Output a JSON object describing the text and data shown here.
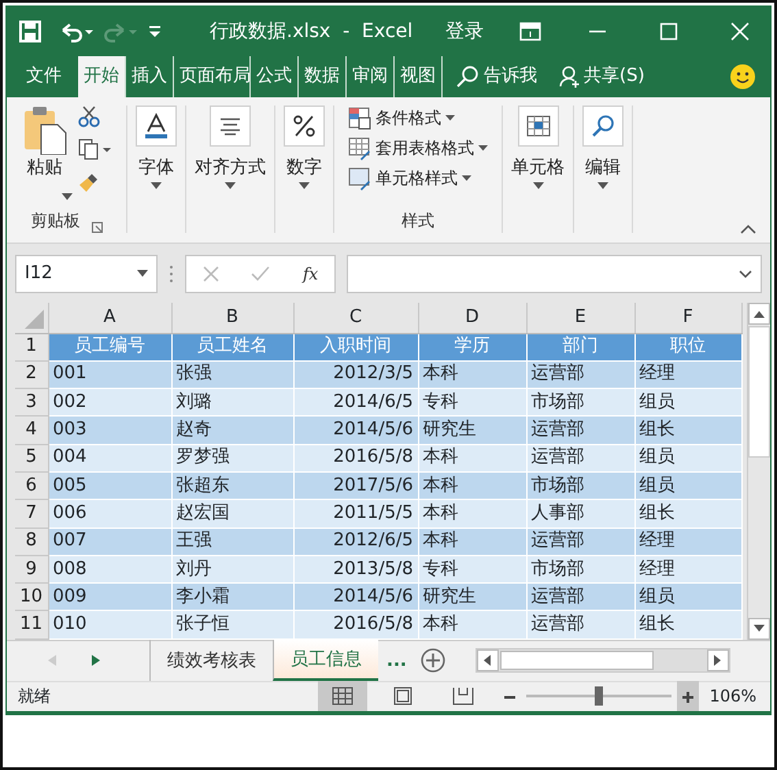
{
  "title_bar": {
    "title": "行政数据.xlsx  -  Excel",
    "sign_in": "登录"
  },
  "ribbon_tabs": [
    {
      "label": "文件",
      "selected": false
    },
    {
      "label": "开始",
      "selected": true
    },
    {
      "label": "插入",
      "selected": false
    },
    {
      "label": "页面布局",
      "selected": false
    },
    {
      "label": "公式",
      "selected": false
    },
    {
      "label": "数据",
      "selected": false
    },
    {
      "label": "审阅",
      "selected": false
    },
    {
      "label": "视图",
      "selected": false
    }
  ],
  "tell_me": "告诉我",
  "share": "共享(S)",
  "ribbon": {
    "clipboard": {
      "paste": "粘贴",
      "label": "剪贴板"
    },
    "font": "字体",
    "alignment": "对齐方式",
    "number": "数字",
    "styles": {
      "items": [
        "条件格式",
        "套用表格格式",
        "单元格样式"
      ],
      "label": "样式"
    },
    "cells": "单元格",
    "editing": "编辑"
  },
  "formula_bar": {
    "name_box": "I12",
    "fx": "fx"
  },
  "sheet": {
    "columns": [
      "A",
      "B",
      "C",
      "D",
      "E",
      "F"
    ],
    "rows": [
      {
        "number": "1",
        "kind": "header",
        "cells": [
          "员工编号",
          "员工姓名",
          "入职时间",
          "学历",
          "部门",
          "职位"
        ]
      },
      {
        "number": "2",
        "kind": "data",
        "cells": [
          "001",
          "张强",
          "2012/3/5",
          "本科",
          "运营部",
          "经理"
        ]
      },
      {
        "number": "3",
        "kind": "data",
        "cells": [
          "002",
          "刘璐",
          "2014/6/5",
          "专科",
          "市场部",
          "组员"
        ]
      },
      {
        "number": "4",
        "kind": "data",
        "cells": [
          "003",
          "赵奇",
          "2014/5/6",
          "研究生",
          "运营部",
          "组长"
        ]
      },
      {
        "number": "5",
        "kind": "data",
        "cells": [
          "004",
          "罗梦强",
          "2016/5/8",
          "本科",
          "运营部",
          "组员"
        ]
      },
      {
        "number": "6",
        "kind": "data",
        "cells": [
          "005",
          "张超东",
          "2017/5/6",
          "本科",
          "市场部",
          "组员"
        ]
      },
      {
        "number": "7",
        "kind": "data",
        "cells": [
          "006",
          "赵宏国",
          "2011/5/5",
          "本科",
          "人事部",
          "组长"
        ]
      },
      {
        "number": "8",
        "kind": "data",
        "cells": [
          "007",
          "王强",
          "2012/6/5",
          "本科",
          "运营部",
          "经理"
        ]
      },
      {
        "number": "9",
        "kind": "data",
        "cells": [
          "008",
          "刘丹",
          "2013/5/8",
          "专科",
          "市场部",
          "经理"
        ]
      },
      {
        "number": "10",
        "kind": "data",
        "cells": [
          "009",
          "李小霜",
          "2014/5/6",
          "研究生",
          "运营部",
          "组员"
        ]
      },
      {
        "number": "11",
        "kind": "data",
        "cells": [
          "010",
          "张子恒",
          "2016/5/8",
          "本科",
          "运营部",
          "组长"
        ]
      }
    ]
  },
  "sheet_tabs": [
    {
      "label": "绩效考核表",
      "selected": false
    },
    {
      "label": "员工信息",
      "selected": true
    }
  ],
  "more_sheets": "...",
  "status_bar": {
    "status": "就绪",
    "views": [
      {
        "kind": "normal",
        "selected": true
      },
      {
        "kind": "page_layout",
        "selected": false
      },
      {
        "kind": "page_break",
        "selected": false
      }
    ],
    "zoom": {
      "level": 0.5
    },
    "zoom_text": "106%"
  }
}
